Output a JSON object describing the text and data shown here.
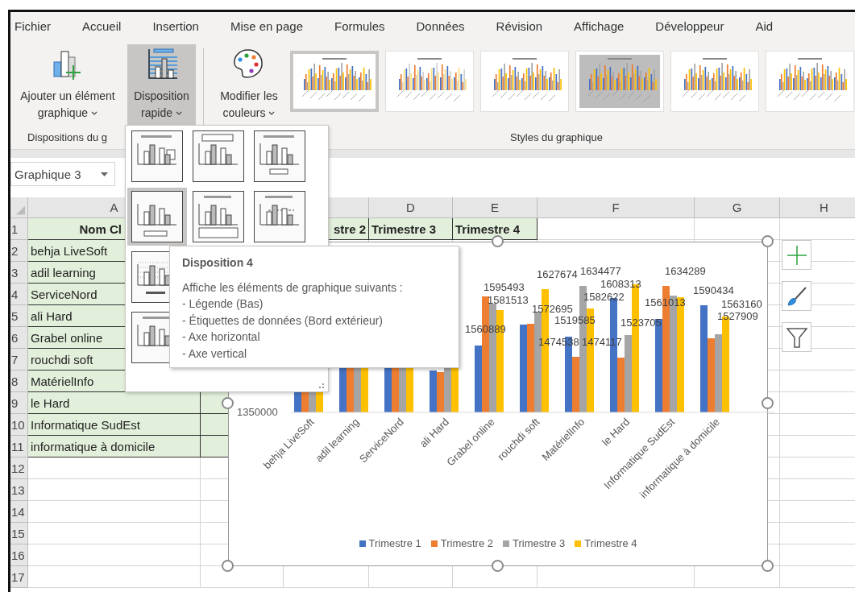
{
  "menu_tabs": [
    "Fichier",
    "Accueil",
    "Insertion",
    "Mise en page",
    "Formules",
    "Données",
    "Révision",
    "Affichage",
    "Développeur",
    "Aid"
  ],
  "ribbon_buttons": [
    {
      "kind": "add-element",
      "line1": "Ajouter un élément",
      "line2": "graphique",
      "selected": false
    },
    {
      "kind": "quick-layout",
      "line1": "Disposition",
      "line2": "rapide",
      "selected": true
    },
    {
      "kind": "colors",
      "line1": "Modifier les",
      "line2": "couleurs",
      "selected": false
    }
  ],
  "style_gallery": [
    {
      "kind": "plain",
      "selected": true
    },
    {
      "kind": "stacked",
      "selected": false
    },
    {
      "kind": "plain",
      "selected": false
    },
    {
      "kind": "gradient",
      "selected": false
    },
    {
      "kind": "plain",
      "selected": false
    },
    {
      "kind": "plain",
      "selected": false
    }
  ],
  "group_labels": [
    "Dispositions du g",
    "Styles du graphique"
  ],
  "name_box": "Graphique 3",
  "column_headers": [
    "A",
    "D",
    "E",
    "F",
    "G",
    "H"
  ],
  "rows": [
    {
      "number": "1",
      "kind": "header",
      "cells": [
        "Nom Cl",
        "stre 2",
        "Trimestre 3",
        "Trimestre 4"
      ]
    },
    {
      "number": "2",
      "kind": "data",
      "cells": [
        "behja LiveSoft"
      ]
    },
    {
      "number": "3",
      "kind": "data",
      "cells": [
        "adil learning"
      ]
    },
    {
      "number": "4",
      "kind": "data",
      "cells": [
        "ServiceNord"
      ]
    },
    {
      "number": "5",
      "kind": "data",
      "cells": [
        "ali Hard"
      ]
    },
    {
      "number": "6",
      "kind": "data",
      "cells": [
        "Grabel online"
      ]
    },
    {
      "number": "7",
      "kind": "data",
      "cells": [
        "rouchdi soft"
      ]
    },
    {
      "number": "8",
      "kind": "data",
      "cells": [
        "MatérielInfo"
      ]
    },
    {
      "number": "9",
      "kind": "data",
      "cells": [
        "le Hard"
      ]
    },
    {
      "number": "10",
      "kind": "data",
      "cells": [
        "Informatique SudEst"
      ]
    },
    {
      "number": "11",
      "kind": "data",
      "cells": [
        "informatique à domicile"
      ]
    },
    {
      "number": "12",
      "kind": "empty",
      "cells": []
    },
    {
      "number": "13",
      "kind": "empty",
      "cells": []
    },
    {
      "number": "14",
      "kind": "empty",
      "cells": []
    },
    {
      "number": "15",
      "kind": "empty",
      "cells": []
    },
    {
      "number": "16",
      "kind": "empty",
      "cells": []
    },
    {
      "number": "17",
      "kind": "empty",
      "cells": []
    }
  ],
  "chart": {
    "y_tick": "1350000",
    "categories": [
      "behja LiveSoft",
      "adil learning",
      "ServiceNord",
      "ali Hard",
      "Grabel online",
      "rouchdi soft",
      "MatérielInfo",
      "le Hard",
      "Informatique SudEst",
      "informatique à domicile"
    ],
    "data_labels": [
      "1634477",
      "1634289",
      "1627674",
      "1608313",
      "1595493",
      "1590434",
      "1582622",
      "1581513",
      "1561013",
      "1563160",
      "1572695",
      "1527909",
      "1519585",
      "1523705",
      "1560889",
      "1474538",
      "1474117"
    ],
    "legend": [
      {
        "label": "Trimestre 1",
        "color": "#4472c4"
      },
      {
        "label": "Trimestre 2",
        "color": "#ed7d31"
      },
      {
        "label": "Trimestre 3",
        "color": "#a5a5a5"
      },
      {
        "label": "Trimestre 4",
        "color": "#ffc000"
      }
    ]
  },
  "layout_gallery": [
    {
      "selected": false
    },
    {
      "selected": false
    },
    {
      "selected": false
    },
    {
      "selected": true
    },
    {
      "selected": false
    },
    {
      "selected": false
    },
    {
      "selected": false
    },
    {
      "selected": false
    }
  ],
  "tooltip": {
    "title": "Disposition 4",
    "intro": "Affiche les éléments de graphique suivants :",
    "items": [
      "- Légende (Bas)",
      "- Étiquettes de données (Bord extérieur)",
      "- Axe horizontal",
      "- Axe vertical"
    ]
  }
}
